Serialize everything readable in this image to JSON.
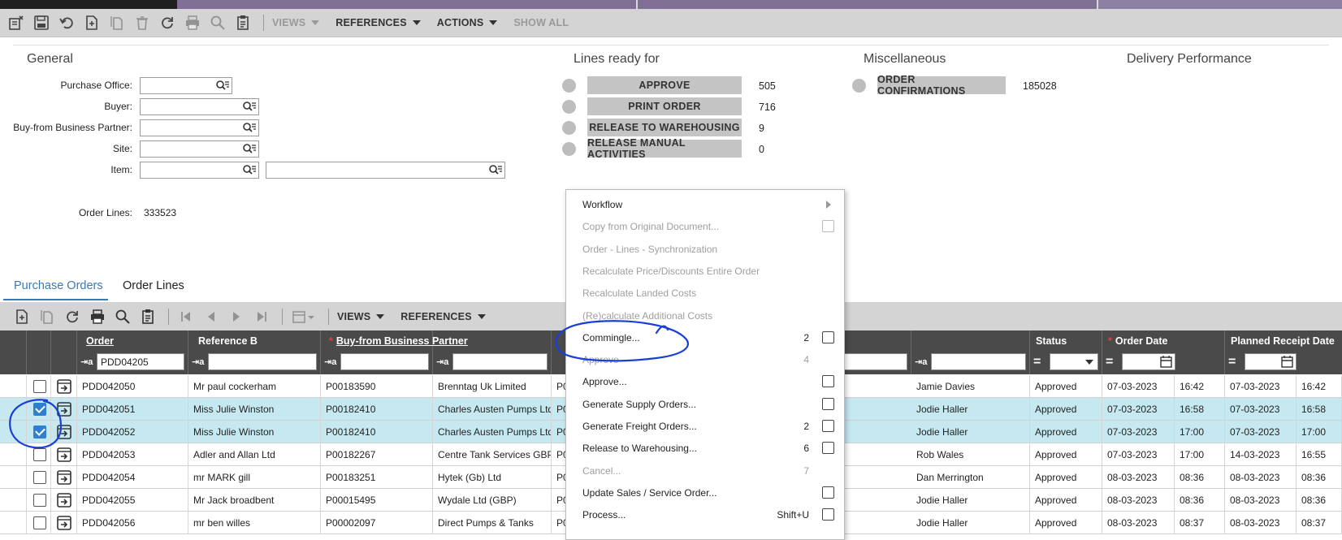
{
  "toolbar": {
    "views_label": "VIEWS",
    "references_label": "REFERENCES",
    "actions_label": "ACTIONS",
    "show_all_label": "SHOW ALL"
  },
  "general": {
    "title": "General",
    "purchase_office_label": "Purchase Office:",
    "buyer_label": "Buyer:",
    "business_partner_label": "Buy-from Business Partner:",
    "site_label": "Site:",
    "item_label": "Item:",
    "order_lines_label": "Order Lines:",
    "order_lines_value": "333523"
  },
  "lines_ready": {
    "title": "Lines ready for",
    "items": [
      {
        "label": "APPROVE",
        "count": "505"
      },
      {
        "label": "PRINT ORDER",
        "count": "716"
      },
      {
        "label": "RELEASE TO WAREHOUSING",
        "count": "9"
      },
      {
        "label": "RELEASE MANUAL ACTIVITIES",
        "count": "0"
      }
    ]
  },
  "misc": {
    "title": "Miscellaneous",
    "order_confirmations_label": "ORDER CONFIRMATIONS",
    "order_confirmations_count": "185028"
  },
  "delivery": {
    "title": "Delivery Performance"
  },
  "tabs": [
    {
      "label": "Purchase Orders"
    },
    {
      "label": "Order Lines"
    }
  ],
  "grid_toolbar": {
    "views_label": "VIEWS",
    "references_label": "REFERENCES"
  },
  "grid": {
    "headers": {
      "order": "Order",
      "reference_b": "Reference B",
      "buy_from": "Buy-from Business Partner",
      "status": "Status",
      "order_date": "Order Date",
      "planned_receipt": "Planned Receipt Date"
    },
    "filter_prefix": "⇥a",
    "order_filter_value": "PDD04205",
    "rows": [
      {
        "order": "PDD042050",
        "ref": "Mr paul cockerham",
        "bp": "P00183590",
        "bp_name": "Brenntag Uk Limited",
        "p": "P0",
        "buyer": "Jamie Davies",
        "status": "Approved",
        "odate": "07-03-2023",
        "otime": "16:42",
        "pdate": "07-03-2023",
        "ptime": "16:42",
        "checked": false
      },
      {
        "order": "PDD042051",
        "ref": "Miss Julie Winston",
        "bp": "P00182410",
        "bp_name": "Charles Austen Pumps Ltd",
        "p": "P0",
        "buyer": "Jodie Haller",
        "status": "Approved",
        "odate": "07-03-2023",
        "otime": "16:58",
        "pdate": "07-03-2023",
        "ptime": "16:58",
        "checked": true
      },
      {
        "order": "PDD042052",
        "ref": "Miss Julie Winston",
        "bp": "P00182410",
        "bp_name": "Charles Austen Pumps Ltd",
        "p": "P0",
        "buyer": "Jodie Haller",
        "status": "Approved",
        "odate": "07-03-2023",
        "otime": "17:00",
        "pdate": "07-03-2023",
        "ptime": "17:00",
        "checked": true
      },
      {
        "order": "PDD042053",
        "ref": "Adler and Allan Ltd",
        "bp": "P00182267",
        "bp_name": "Centre Tank Services GBP",
        "p": "P0",
        "buyer": "Rob Wales",
        "status": "Approved",
        "odate": "07-03-2023",
        "otime": "17:00",
        "pdate": "14-03-2023",
        "ptime": "16:55",
        "checked": false
      },
      {
        "order": "PDD042054",
        "ref": "mr MARK gill",
        "bp": "P00183251",
        "bp_name": "Hytek (Gb) Ltd",
        "p": "P0",
        "buyer": "Dan Merrington",
        "status": "Approved",
        "odate": "08-03-2023",
        "otime": "08:36",
        "pdate": "08-03-2023",
        "ptime": "08:36",
        "checked": false
      },
      {
        "order": "PDD042055",
        "ref": "Mr Jack broadbent",
        "bp": "P00015495",
        "bp_name": "Wydale Ltd (GBP)",
        "p": "P0",
        "buyer": "Jodie Haller",
        "status": "Approved",
        "odate": "08-03-2023",
        "otime": "08:36",
        "pdate": "08-03-2023",
        "ptime": "08:36",
        "checked": false
      },
      {
        "order": "PDD042056",
        "ref": "mr ben willes",
        "bp": "P00002097",
        "bp_name": "Direct Pumps & Tanks",
        "p": "P0",
        "buyer": "Jodie Haller",
        "status": "Approved",
        "odate": "08-03-2023",
        "otime": "08:37",
        "pdate": "08-03-2023",
        "ptime": "08:37",
        "checked": false
      }
    ]
  },
  "context_menu": {
    "items": [
      {
        "label": "Workflow",
        "count": "",
        "disabled": false,
        "submenu": true,
        "checkbox": false
      },
      {
        "label": "Copy from Original Document...",
        "count": "",
        "disabled": true,
        "submenu": false,
        "checkbox": true
      },
      {
        "label": "Order - Lines - Synchronization",
        "count": "",
        "disabled": true,
        "submenu": false,
        "checkbox": false
      },
      {
        "label": "Recalculate Price/Discounts Entire Order",
        "count": "",
        "disabled": true,
        "submenu": false,
        "checkbox": false
      },
      {
        "label": "Recalculate Landed Costs",
        "count": "",
        "disabled": true,
        "submenu": false,
        "checkbox": false
      },
      {
        "label": "(Re)calculate Additional Costs",
        "count": "",
        "disabled": true,
        "submenu": false,
        "checkbox": false
      },
      {
        "label": "Commingle...",
        "count": "2",
        "disabled": false,
        "submenu": false,
        "checkbox": true
      },
      {
        "label": "Approve",
        "count": "4",
        "disabled": true,
        "submenu": false,
        "checkbox": false
      },
      {
        "label": "Approve...",
        "count": "",
        "disabled": false,
        "submenu": false,
        "checkbox": true
      },
      {
        "label": "Generate Supply Orders...",
        "count": "",
        "disabled": false,
        "submenu": false,
        "checkbox": true
      },
      {
        "label": "Generate Freight Orders...",
        "count": "2",
        "disabled": false,
        "submenu": false,
        "checkbox": true
      },
      {
        "label": "Release to Warehousing...",
        "count": "6",
        "disabled": false,
        "submenu": false,
        "checkbox": true
      },
      {
        "label": "Cancel...",
        "count": "7",
        "disabled": true,
        "submenu": false,
        "checkbox": false
      },
      {
        "label": "Update Sales / Service Order...",
        "count": "",
        "disabled": false,
        "submenu": false,
        "checkbox": true
      },
      {
        "label": "Process...",
        "count": "Shift+U",
        "disabled": false,
        "submenu": false,
        "checkbox": true
      }
    ]
  },
  "colors": {
    "accent": "#3c78b4",
    "annotation": "#1a3fd6",
    "selected_row": "#c6e9f1",
    "header_bg": "#4a4a4a"
  }
}
